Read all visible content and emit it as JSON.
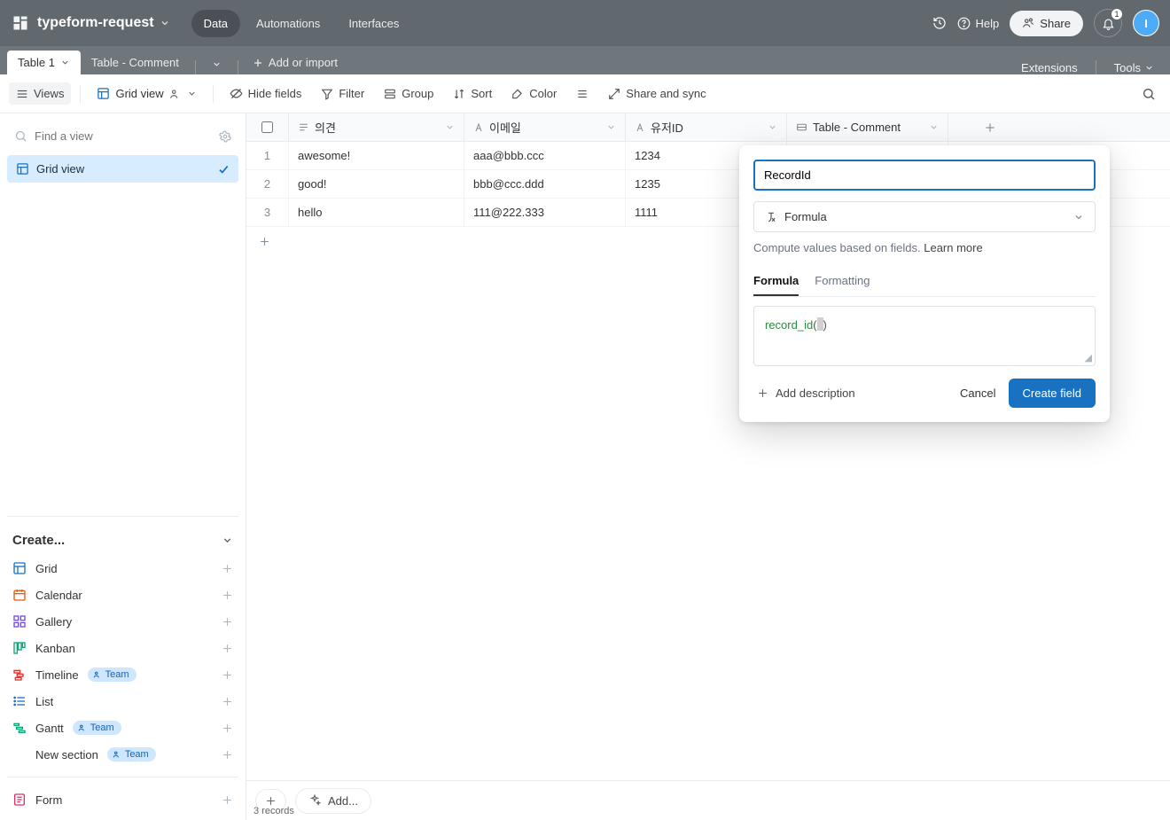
{
  "header": {
    "base_name": "typeform-request",
    "tabs": {
      "data": "Data",
      "automations": "Automations",
      "interfaces": "Interfaces"
    },
    "help": "Help",
    "share": "Share",
    "bell_badge": "1",
    "avatar_initial": "I"
  },
  "tabbar": {
    "active_table": "Table 1",
    "other_table": "Table - Comment",
    "add_or_import": "Add or import",
    "extensions": "Extensions",
    "tools": "Tools"
  },
  "toolbar": {
    "views": "Views",
    "grid_view": "Grid view",
    "hide_fields": "Hide fields",
    "filter": "Filter",
    "group": "Group",
    "sort": "Sort",
    "color": "Color",
    "share_sync": "Share and sync"
  },
  "sidebar": {
    "find_placeholder": "Find a view",
    "active_view": "Grid view",
    "create_label": "Create...",
    "items": [
      {
        "label": "Grid",
        "icon": "grid"
      },
      {
        "label": "Calendar",
        "icon": "calendar"
      },
      {
        "label": "Gallery",
        "icon": "gallery"
      },
      {
        "label": "Kanban",
        "icon": "kanban"
      },
      {
        "label": "Timeline",
        "icon": "timeline",
        "badge": "Team"
      },
      {
        "label": "List",
        "icon": "list"
      },
      {
        "label": "Gantt",
        "icon": "gantt",
        "badge": "Team"
      },
      {
        "label": "New section",
        "icon": "",
        "badge": "Team"
      },
      {
        "label": "Form",
        "icon": "form"
      }
    ]
  },
  "columns": {
    "c1": "의견",
    "c2": "이메일",
    "c3": "유저ID",
    "c4": "Table - Comment"
  },
  "rows": [
    {
      "n": "1",
      "c1": "awesome!",
      "c2": "aaa@bbb.ccc",
      "c3": "1234"
    },
    {
      "n": "2",
      "c1": "good!",
      "c2": "bbb@ccc.ddd",
      "c3": "1235"
    },
    {
      "n": "3",
      "c1": "hello",
      "c2": "111@222.333",
      "c3": "1111"
    }
  ],
  "footer": {
    "add_label": "Add...",
    "records": "3 records"
  },
  "popover": {
    "field_name": "RecordId",
    "type_label": "Formula",
    "desc": "Compute values based on fields. ",
    "learn": "Learn more",
    "tab_formula": "Formula",
    "tab_formatting": "Formatting",
    "formula_fn": "record_id",
    "add_desc": "Add description",
    "cancel": "Cancel",
    "create": "Create field"
  }
}
